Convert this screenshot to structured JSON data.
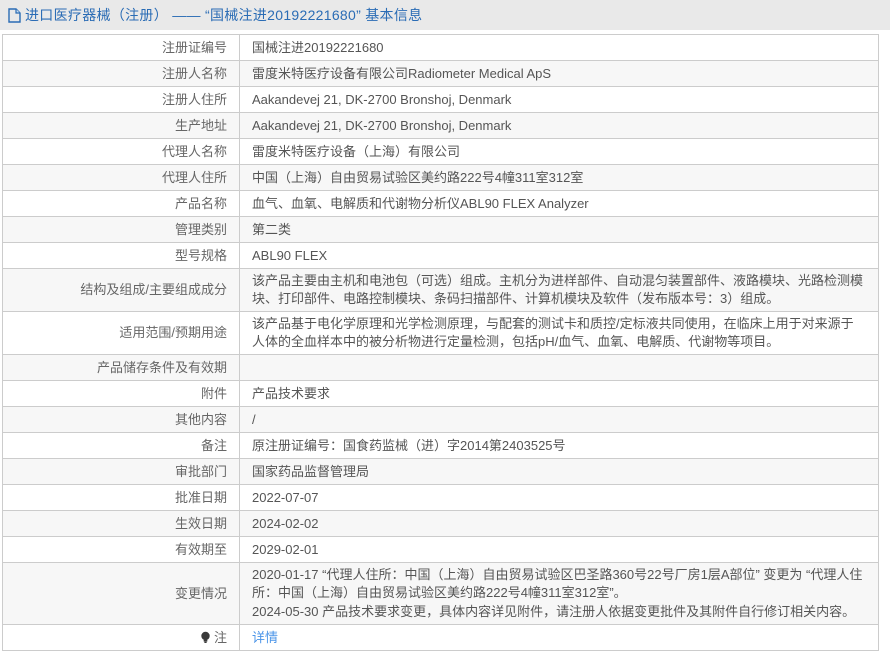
{
  "header": {
    "icon": "document-icon",
    "title": "进口医疗器械（注册） —— “国械注进20192221680” 基本信息"
  },
  "colors": {
    "title_blue": "#2a6cb5",
    "link_blue": "#4a94e8",
    "band_bg": "#e9e9e9",
    "row_alt": "#f7f7f7",
    "border": "#cccccc"
  },
  "table": {
    "rows": [
      {
        "label": "注册证编号",
        "value": "国械注进20192221680"
      },
      {
        "label": "注册人名称",
        "value": "雷度米特医疗设备有限公司Radiometer Medical ApS"
      },
      {
        "label": "注册人住所",
        "value": "Aakandevej 21, DK-2700 Bronshoj, Denmark"
      },
      {
        "label": "生产地址",
        "value": "Aakandevej 21, DK-2700 Bronshoj, Denmark"
      },
      {
        "label": "代理人名称",
        "value": "雷度米特医疗设备（上海）有限公司"
      },
      {
        "label": "代理人住所",
        "value": "中国（上海）自由贸易试验区美约路222号4幢311室312室"
      },
      {
        "label": "产品名称",
        "value": "血气、血氧、电解质和代谢物分析仪ABL90 FLEX Analyzer"
      },
      {
        "label": "管理类别",
        "value": "第二类"
      },
      {
        "label": "型号规格",
        "value": "ABL90 FLEX"
      },
      {
        "label": "结构及组成/主要组成成分",
        "value": "该产品主要由主机和电池包（可选）组成。主机分为进样部件、自动混匀装置部件、液路模块、光路检测模块、打印部件、电路控制模块、条码扫描部件、计算机模块及软件（发布版本号：3）组成。"
      },
      {
        "label": "适用范围/预期用途",
        "value": "该产品基于电化学原理和光学检测原理，与配套的测试卡和质控/定标液共同使用，在临床上用于对来源于人体的全血样本中的被分析物进行定量检测，包括pH/血气、血氧、电解质、代谢物等项目。"
      },
      {
        "label": "产品储存条件及有效期",
        "value": ""
      },
      {
        "label": "附件",
        "value": "产品技术要求"
      },
      {
        "label": "其他内容",
        "value": "/"
      },
      {
        "label": "备注",
        "value": "原注册证编号：国食药监械（进）字2014第2403525号"
      },
      {
        "label": "审批部门",
        "value": "国家药品监督管理局"
      },
      {
        "label": "批准日期",
        "value": "2022-07-07"
      },
      {
        "label": "生效日期",
        "value": "2024-02-02"
      },
      {
        "label": "有效期至",
        "value": "2029-02-01"
      },
      {
        "label": "变更情况",
        "value_lines": [
          "2020-01-17 “代理人住所：中国（上海）自由贸易试验区巴圣路360号22号厂房1层A部位” 变更为 “代理人住所：中国（上海）自由贸易试验区美约路222号4幢311室312室”。",
          "2024-05-30 产品技术要求变更，具体内容详见附件，请注册人依据变更批件及其附件自行修订相关内容。"
        ]
      },
      {
        "label": "注",
        "label_icon": "note-icon",
        "value": "详情",
        "is_link": true
      }
    ]
  }
}
